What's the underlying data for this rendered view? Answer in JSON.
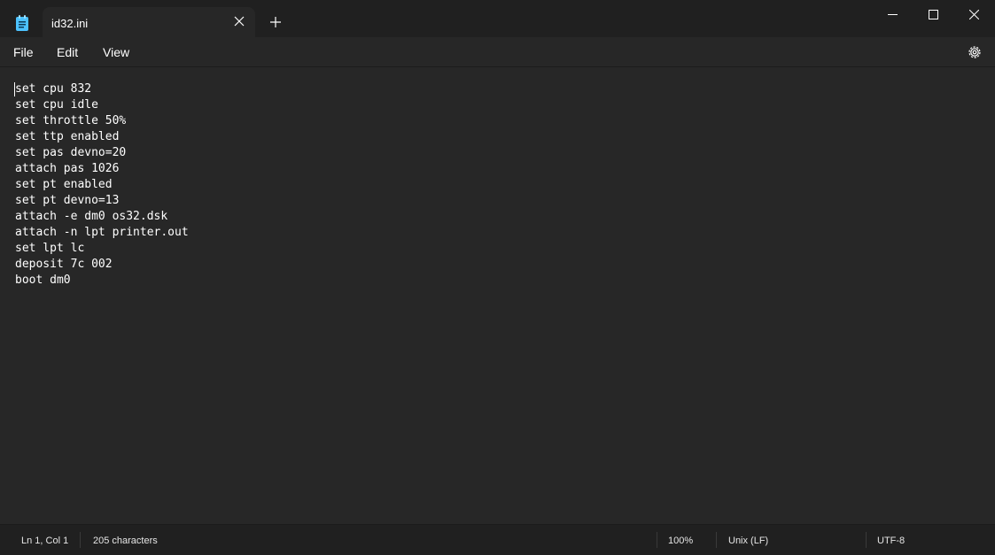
{
  "tab": {
    "title": "id32.ini"
  },
  "menu": {
    "file": "File",
    "edit": "Edit",
    "view": "View"
  },
  "editor": {
    "lines": [
      "set cpu 832",
      "set cpu idle",
      "set throttle 50%",
      "set ttp enabled",
      "set pas devno=20",
      "attach pas 1026",
      "set pt enabled",
      "set pt devno=13",
      "attach -e dm0 os32.dsk",
      "attach -n lpt printer.out",
      "set lpt lc",
      "deposit 7c 002",
      "boot dm0"
    ]
  },
  "status": {
    "position": "Ln 1, Col 1",
    "characters": "205 characters",
    "zoom": "100%",
    "line_ending": "Unix (LF)",
    "encoding": "UTF-8"
  },
  "icons": {
    "app": "notepad-icon",
    "close_tab": "close-icon",
    "new_tab": "plus-icon",
    "minimize": "minimize-icon",
    "maximize": "maximize-icon",
    "close_window": "close-icon",
    "settings": "gear-icon"
  },
  "colors": {
    "background": "#202020",
    "editor": "#272727",
    "text": "#ffffff",
    "app_icon": "#4cc2ff"
  }
}
